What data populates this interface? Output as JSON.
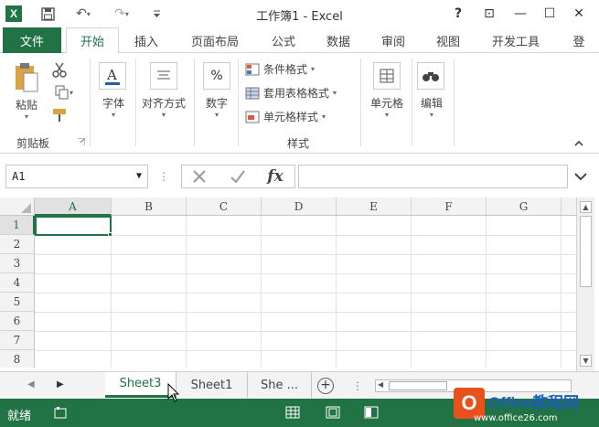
{
  "window": {
    "title": "工作簿1 - Excel",
    "app_icon_label": "X",
    "help_label": "?",
    "restore_ribbon_label": "⊡",
    "minimize_label": "—",
    "maximize_label": "☐",
    "close_label": "✕"
  },
  "quick_access": {
    "save": "save-icon",
    "undo": "↶",
    "redo": "↷",
    "more": "▾"
  },
  "tabs": [
    {
      "label": "文件"
    },
    {
      "label": "开始"
    },
    {
      "label": "插入"
    },
    {
      "label": "页面布局"
    },
    {
      "label": "公式"
    },
    {
      "label": "数据"
    },
    {
      "label": "审阅"
    },
    {
      "label": "视图"
    },
    {
      "label": "开发工具"
    },
    {
      "label": "登"
    }
  ],
  "ribbon": {
    "clipboard": {
      "paste_label": "粘贴",
      "group_label": "剪贴板"
    },
    "font_label": "字体",
    "alignment_label": "对齐方式",
    "number_label": "数字",
    "number_icon": "%",
    "styles": {
      "conditional_format": "条件格式",
      "table_format": "套用表格格式",
      "cell_styles": "单元格样式",
      "group_label": "样式"
    },
    "cells_label": "单元格",
    "editing_label": "编辑"
  },
  "formula_bar": {
    "name_box": "A1",
    "fx_label": "fx",
    "formula": ""
  },
  "grid": {
    "columns": [
      "A",
      "B",
      "C",
      "D",
      "E",
      "F",
      "G"
    ],
    "rows": [
      "1",
      "2",
      "3",
      "4",
      "5",
      "6",
      "7",
      "8"
    ],
    "active_cell": "A1"
  },
  "sheets": [
    {
      "label": "Sheet3",
      "active": true
    },
    {
      "label": "Sheet1",
      "active": false
    },
    {
      "label": "She ...",
      "active": false
    }
  ],
  "status": {
    "text": "就绪"
  },
  "watermark": {
    "title": "Office教程网",
    "url": "www.office26.com"
  },
  "colors": {
    "accent": "#217346",
    "watermark_orange": "#e8501c"
  }
}
